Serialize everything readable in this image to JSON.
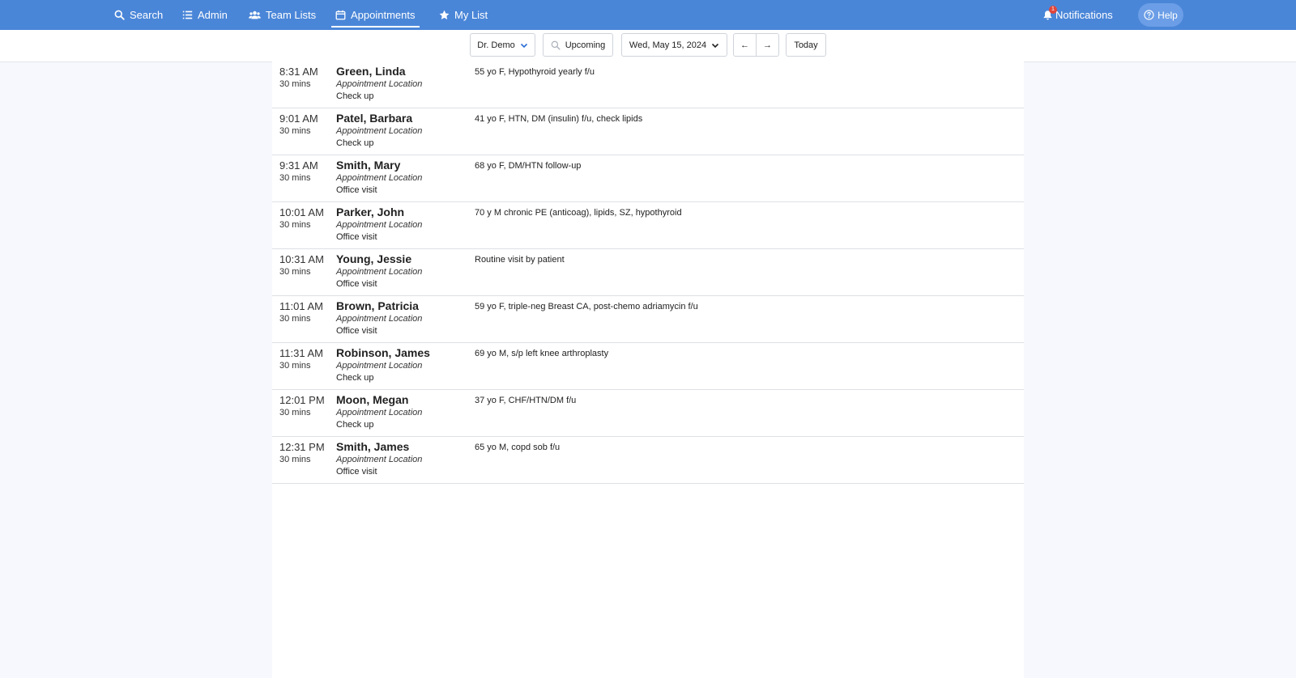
{
  "nav": {
    "items": [
      {
        "label": "Search",
        "icon": "search-icon"
      },
      {
        "label": "Admin",
        "icon": "list-icon"
      },
      {
        "label": "Team Lists",
        "icon": "users-icon"
      },
      {
        "label": "Appointments",
        "icon": "calendar-icon",
        "active": true
      },
      {
        "label": "My List",
        "icon": "star-icon"
      }
    ],
    "notifications": {
      "label": "Notifications",
      "badge": "1"
    },
    "help": {
      "label": "Help"
    }
  },
  "toolbar": {
    "provider": "Dr. Demo",
    "filter": "Upcoming",
    "date": "Wed, May 15, 2024",
    "prev": "←",
    "next": "→",
    "today": "Today"
  },
  "appointments": [
    {
      "time": "8:31 AM",
      "duration": "30 mins",
      "name": "Green, Linda",
      "location": "Appointment Location",
      "type": "Check up",
      "note": "55 yo F, Hypothyroid yearly f/u"
    },
    {
      "time": "9:01 AM",
      "duration": "30 mins",
      "name": "Patel, Barbara",
      "location": "Appointment Location",
      "type": "Check up",
      "note": "41 yo F, HTN, DM (insulin) f/u, check lipids"
    },
    {
      "time": "9:31 AM",
      "duration": "30 mins",
      "name": "Smith, Mary",
      "location": "Appointment Location",
      "type": "Office visit",
      "note": "68 yo F, DM/HTN follow-up"
    },
    {
      "time": "10:01 AM",
      "duration": "30 mins",
      "name": "Parker, John",
      "location": "Appointment Location",
      "type": "Office visit",
      "note": "70 y M chronic PE (anticoag), lipids, SZ, hypothyroid"
    },
    {
      "time": "10:31 AM",
      "duration": "30 mins",
      "name": "Young, Jessie",
      "location": "Appointment Location",
      "type": "Office visit",
      "note": "Routine visit by patient"
    },
    {
      "time": "11:01 AM",
      "duration": "30 mins",
      "name": "Brown, Patricia",
      "location": "Appointment Location",
      "type": "Office visit",
      "note": "59 yo F, triple-neg Breast CA, post-chemo adriamycin f/u"
    },
    {
      "time": "11:31 AM",
      "duration": "30 mins",
      "name": "Robinson, James",
      "location": "Appointment Location",
      "type": "Check up",
      "note": "69 yo M, s/p left knee arthroplasty"
    },
    {
      "time": "12:01 PM",
      "duration": "30 mins",
      "name": "Moon, Megan",
      "location": "Appointment Location",
      "type": "Check up",
      "note": "37 yo F, CHF/HTN/DM f/u"
    },
    {
      "time": "12:31 PM",
      "duration": "30 mins",
      "name": "Smith, James",
      "location": "Appointment Location",
      "type": "Office visit",
      "note": "65 yo M, copd sob f/u"
    }
  ]
}
